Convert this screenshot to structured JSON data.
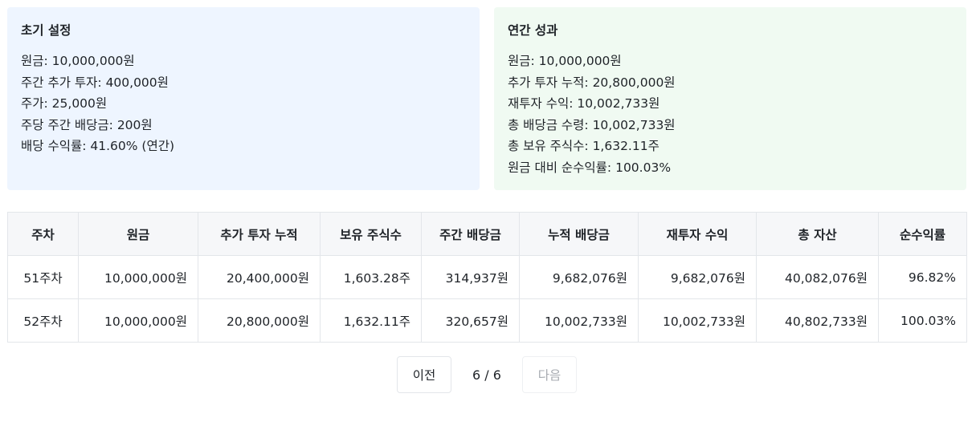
{
  "setup": {
    "title": "초기 설정",
    "lines": [
      "원금: 10,000,000원",
      "주간 추가 투자: 400,000원",
      "주가: 25,000원",
      "주당 주간 배당금: 200원",
      "배당 수익률: 41.60% (연간)"
    ]
  },
  "performance": {
    "title": "연간 성과",
    "lines": [
      "원금: 10,000,000원",
      "추가 투자 누적: 20,800,000원",
      "재투자 수익: 10,002,733원",
      "총 배당금 수령: 10,002,733원",
      "총 보유 주식수: 1,632.11주",
      "원금 대비 순수익률: 100.03%"
    ]
  },
  "table": {
    "headers": [
      "주차",
      "원금",
      "추가 투자 누적",
      "보유 주식수",
      "주간 배당금",
      "누적 배당금",
      "재투자 수익",
      "총 자산",
      "순수익률"
    ],
    "rows": [
      [
        "51주차",
        "10,000,000원",
        "20,400,000원",
        "1,603.28주",
        "314,937원",
        "9,682,076원",
        "9,682,076원",
        "40,082,076원",
        "96.82%"
      ],
      [
        "52주차",
        "10,000,000원",
        "20,800,000원",
        "1,632.11주",
        "320,657원",
        "10,002,733원",
        "10,002,733원",
        "40,802,733원",
        "100.03%"
      ]
    ]
  },
  "pagination": {
    "prev_label": "이전",
    "page_info": "6 / 6",
    "next_label": "다음",
    "next_disabled": true
  }
}
